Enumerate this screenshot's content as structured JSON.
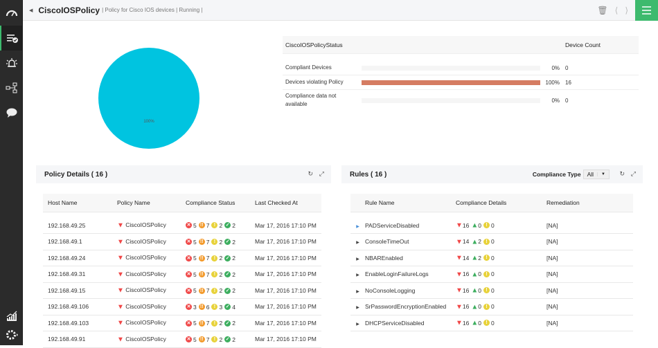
{
  "sidebar": {
    "items": [
      "dashboard-icon",
      "compliance-policy-icon",
      "alarm-icon",
      "network-map-icon",
      "chat-icon",
      "reports-icon",
      "settings-icon"
    ],
    "active": "compliance-policy-icon"
  },
  "header": {
    "title": "CiscoIOSPolicy",
    "subtitle": "| Policy for Cisco IOS devices | Running |"
  },
  "pie": {
    "label": "100%",
    "color": "#00c4e0",
    "slices": [
      {
        "name": "Devices violating Policy",
        "value": 100
      }
    ]
  },
  "status": {
    "col_status": "CiscoIOSPolicyStatus",
    "col_count": "Device Count",
    "bar_color": "#d57c62",
    "rows": [
      {
        "label": "Compliant Devices",
        "percent": 0,
        "pct_text": "0%",
        "count": "0"
      },
      {
        "label": "Devices violating Policy",
        "percent": 100,
        "pct_text": "100%",
        "count": "16"
      },
      {
        "label": "Compliance data not available",
        "percent": 0,
        "pct_text": "0%",
        "count": "0"
      }
    ]
  },
  "policy_details": {
    "title": "Policy Details ( 16 )",
    "columns": [
      "Host Name",
      "Policy Name",
      "Compliance Status",
      "Last Checked At"
    ],
    "rows": [
      {
        "host": "192.168.49.25",
        "policy": "CiscoIOSPolicy",
        "c": [
          "5",
          "7",
          "2",
          "2"
        ],
        "checked": "Mar 17, 2016 17:10 PM"
      },
      {
        "host": "192.168.49.1",
        "policy": "CiscoIOSPolicy",
        "c": [
          "5",
          "7",
          "2",
          "2"
        ],
        "checked": "Mar 17, 2016 17:10 PM"
      },
      {
        "host": "192.168.49.24",
        "policy": "CiscoIOSPolicy",
        "c": [
          "5",
          "7",
          "2",
          "2"
        ],
        "checked": "Mar 17, 2016 17:10 PM"
      },
      {
        "host": "192.168.49.31",
        "policy": "CiscoIOSPolicy",
        "c": [
          "5",
          "7",
          "2",
          "2"
        ],
        "checked": "Mar 17, 2016 17:10 PM"
      },
      {
        "host": "192.168.49.15",
        "policy": "CiscoIOSPolicy",
        "c": [
          "5",
          "7",
          "2",
          "2"
        ],
        "checked": "Mar 17, 2016 17:10 PM"
      },
      {
        "host": "192.168.49.106",
        "policy": "CiscoIOSPolicy",
        "c": [
          "3",
          "6",
          "3",
          "4"
        ],
        "checked": "Mar 17, 2016 17:10 PM"
      },
      {
        "host": "192.168.49.103",
        "policy": "CiscoIOSPolicy",
        "c": [
          "5",
          "7",
          "2",
          "2"
        ],
        "checked": "Mar 17, 2016 17:10 PM"
      },
      {
        "host": "192.168.49.91",
        "policy": "CiscoIOSPolicy",
        "c": [
          "5",
          "7",
          "2",
          "2"
        ],
        "checked": "Mar 17, 2016 17:10 PM"
      }
    ]
  },
  "rules": {
    "title": "Rules ( 16 )",
    "compliance_type_label": "Compliance Type",
    "compliance_type_value": "All",
    "columns": [
      "Rule Name",
      "Compliance Details",
      "Remediation"
    ],
    "rows": [
      {
        "name": "PADServiceDisabled",
        "down": "16",
        "up": "0",
        "warn": "0",
        "remediation": "[NA]"
      },
      {
        "name": "ConsoleTimeOut",
        "down": "14",
        "up": "2",
        "warn": "0",
        "remediation": "[NA]"
      },
      {
        "name": "NBAREnabled",
        "down": "14",
        "up": "2",
        "warn": "0",
        "remediation": "[NA]"
      },
      {
        "name": "EnableLoginFailureLogs",
        "down": "16",
        "up": "0",
        "warn": "0",
        "remediation": "[NA]"
      },
      {
        "name": "NoConsoleLogging",
        "down": "16",
        "up": "0",
        "warn": "0",
        "remediation": "[NA]"
      },
      {
        "name": "SrPasswordEncryptionEnabled",
        "down": "16",
        "up": "0",
        "warn": "0",
        "remediation": "[NA]"
      },
      {
        "name": "DHCPServiceDisabled",
        "down": "16",
        "up": "0",
        "warn": "0",
        "remediation": "[NA]"
      }
    ]
  },
  "colors": {
    "accent": "#3dba6e",
    "critical": "#f04848",
    "major": "#f39a2b",
    "warning": "#e8d23a",
    "ok": "#3dae5f"
  }
}
